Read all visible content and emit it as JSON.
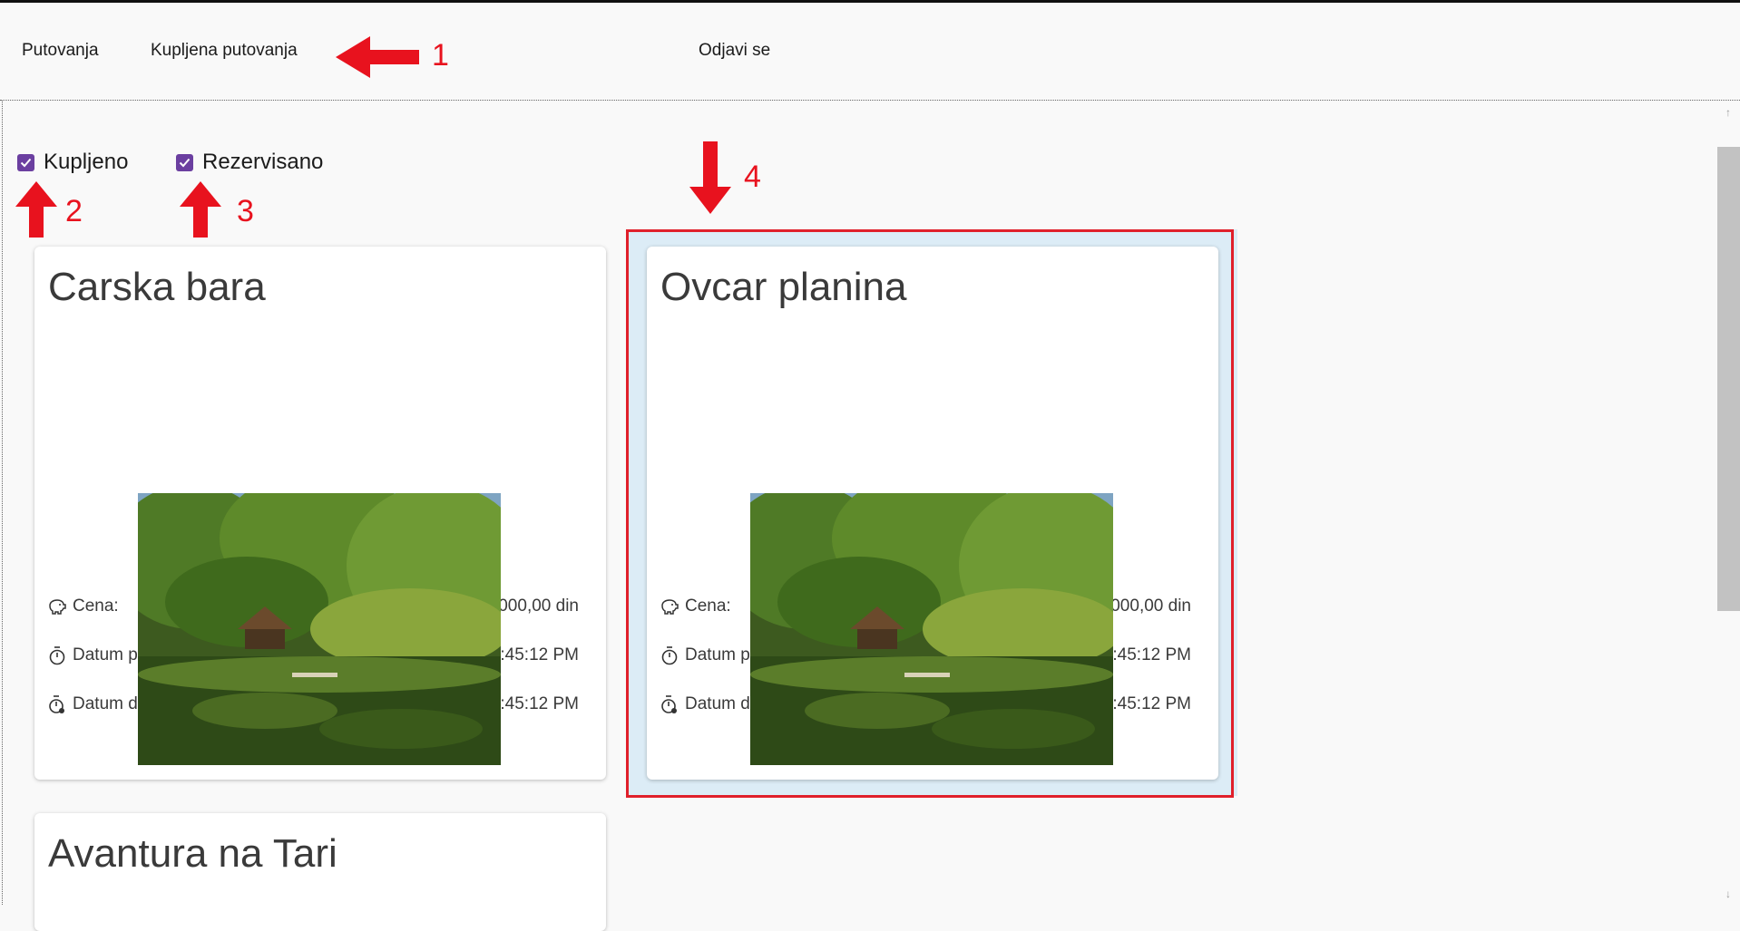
{
  "nav": {
    "items": [
      "Putovanja",
      "Kupljena putovanja"
    ],
    "logout": "Odjavi se"
  },
  "filters": {
    "purchased": {
      "label": "Kupljeno",
      "checked": true
    },
    "reserved": {
      "label": "Rezervisano",
      "checked": true
    }
  },
  "cards": [
    {
      "title": "Carska bara",
      "rows": [
        {
          "icon": "piggy-bank-icon",
          "label": "Cena:",
          "value": "10.000,00 din"
        },
        {
          "icon": "timer-icon",
          "label": "Datum polaska:",
          "value": "6/11/2023 12:45:12 PM"
        },
        {
          "icon": "timer-pin-icon",
          "label": "Datum dolaska:",
          "value": "6/11/2023 12:45:12 PM"
        }
      ]
    },
    {
      "title": "Ovcar planina",
      "rows": [
        {
          "icon": "piggy-bank-icon",
          "label": "Cena:",
          "value": "10.000,00 din"
        },
        {
          "icon": "timer-icon",
          "label": "Datum polaska:",
          "value": "6/11/2023 12:45:12 PM"
        },
        {
          "icon": "timer-pin-icon",
          "label": "Datum dolaska:",
          "value": "6/11/2023 12:45:12 PM"
        }
      ]
    },
    {
      "title": "Avantura na Tari"
    }
  ],
  "annotations": [
    "1",
    "2",
    "3",
    "4"
  ],
  "colors": {
    "accent": "#6b3fa0",
    "annotation": "#e8121e",
    "selected_bg": "#dcecf6"
  }
}
